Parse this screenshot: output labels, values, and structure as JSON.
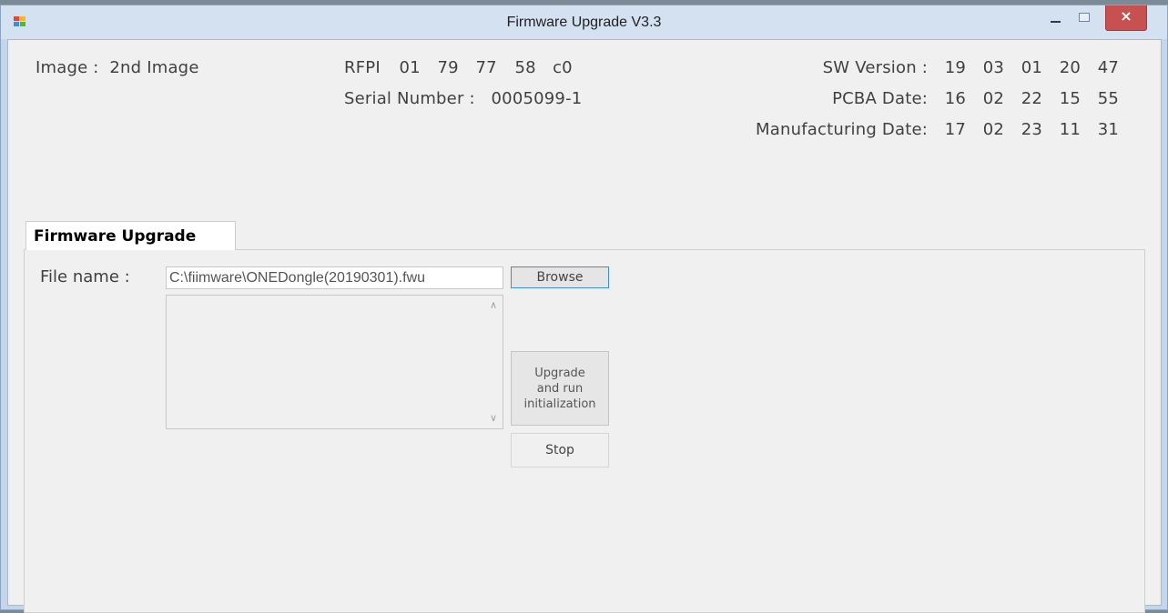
{
  "window": {
    "title": "Firmware Upgrade V3.3",
    "close_glyph": "×"
  },
  "info": {
    "image_label": "Image :",
    "image_value": "2nd Image",
    "rfpi_label": "RFPI",
    "rfpi_values": [
      "01",
      "79",
      "77",
      "58",
      "c0"
    ],
    "serial_label": "Serial Number :",
    "serial_value": "0005099-1",
    "sw_version_label": "SW Version :",
    "sw_version_values": [
      "19",
      "03",
      "01",
      "20",
      "47"
    ],
    "pcba_date_label": "PCBA Date:",
    "pcba_date_values": [
      "16",
      "02",
      "22",
      "15",
      "55"
    ],
    "mfg_date_label": "Manufacturing Date:",
    "mfg_date_values": [
      "17",
      "02",
      "23",
      "11",
      "31"
    ]
  },
  "tab": {
    "label": "Firmware Upgrade"
  },
  "form": {
    "file_name_label": "File name :",
    "file_name_value": "C:\\fiimware\\ONEDongle(20190301).fwu",
    "browse_label": "Browse",
    "upgrade_label_lines": [
      "Upgrade",
      "and run",
      "initialization"
    ],
    "stop_label": "Stop"
  },
  "icons": {
    "app": "app-icon",
    "minimize": "minimize-icon",
    "maximize": "maximize-icon",
    "close": "close-icon",
    "scroll_up": "chevron-up-icon",
    "scroll_down": "chevron-down-icon"
  },
  "colors": {
    "close_button": "#c75050",
    "browse_border": "#3d8bd9"
  }
}
